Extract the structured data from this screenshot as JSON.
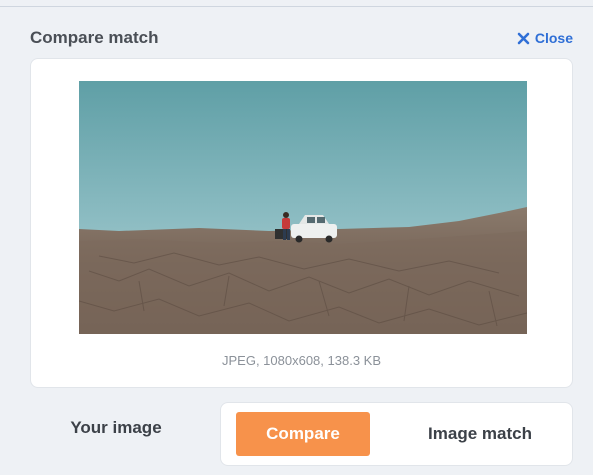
{
  "panel": {
    "title": "Compare match",
    "close_label": "Close"
  },
  "image": {
    "alt": "Person standing next to a white car on a dry, cracked desert plain under a pale blue sky",
    "meta": "JPEG, 1080x608, 138.3 KB"
  },
  "footer": {
    "your_image_label": "Your image",
    "compare_label": "Compare",
    "image_match_label": "Image match"
  },
  "colors": {
    "accent": "#2f6fd6",
    "compare_button": "#f7924b"
  },
  "icons": {
    "close": "close-x-icon"
  }
}
